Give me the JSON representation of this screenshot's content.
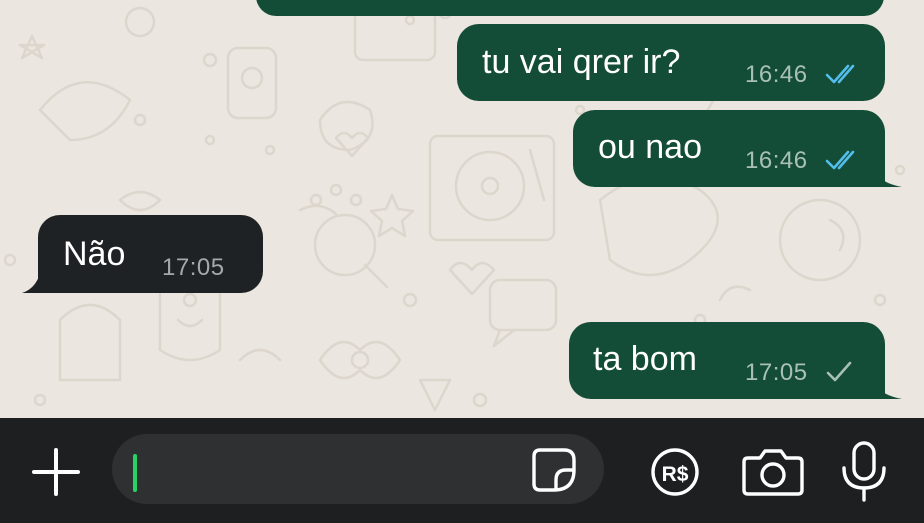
{
  "messages": [
    {
      "direction": "out",
      "text": "tu vai qrer ir?",
      "time": "16:46",
      "status": "read"
    },
    {
      "direction": "out",
      "text": "ou nao",
      "time": "16:46",
      "status": "read"
    },
    {
      "direction": "in",
      "text": "Não",
      "time": "17:05"
    },
    {
      "direction": "out",
      "text": "ta bom",
      "time": "17:05",
      "status": "sent"
    }
  ],
  "composer": {
    "value": "",
    "placeholder": "",
    "pix_label": "R$"
  },
  "colors": {
    "outgoing_bubble": "#144d37",
    "incoming_bubble": "#1f2224",
    "read_ticks": "#53bdeb",
    "sent_tick": "#a9c0b4",
    "caret": "#25d366",
    "input_bar": "#1d1f20"
  },
  "icons": {
    "plus": "plus-icon",
    "sticker": "sticker-icon",
    "pix": "pix-rs-icon",
    "camera": "camera-icon",
    "mic": "microphone-icon",
    "read": "double-check-icon",
    "sent": "single-check-icon"
  }
}
